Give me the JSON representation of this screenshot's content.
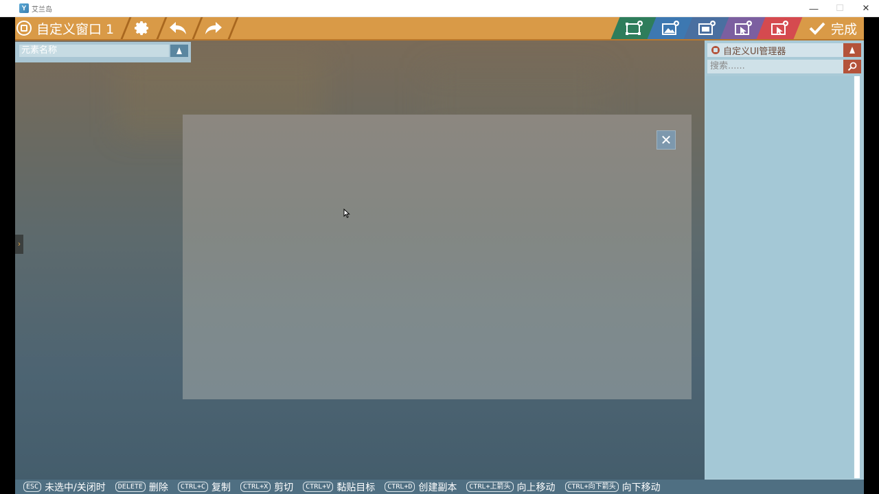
{
  "os_window": {
    "title": "艾兰岛",
    "minimize_glyph": "—",
    "maximize_glyph": "☐",
    "close_glyph": "✕"
  },
  "toolbar": {
    "window_name": "自定义窗口 1",
    "done_label": "完成",
    "colors": {
      "bar": "#d99a47",
      "green": "#2e7d5b",
      "blue": "#3d78b1",
      "slate": "#4a6fa0",
      "purple": "#7c5fa0",
      "red": "#d54a4f"
    },
    "right_tools": [
      {
        "name": "add-frame-icon"
      },
      {
        "name": "add-image-icon"
      },
      {
        "name": "add-panel-icon"
      },
      {
        "name": "add-button-icon"
      },
      {
        "name": "add-clickable-icon"
      }
    ]
  },
  "canvas": {
    "name_placeholder": "元素名称",
    "panel_close_glyph": "✕",
    "side_handle_glyph": "›"
  },
  "right_panel": {
    "title": "自定义UI管理器",
    "search_placeholder": "搜索......"
  },
  "shortcuts": [
    {
      "key": "ESC",
      "label": "未选中/关闭时"
    },
    {
      "key": "DELETE",
      "label": "删除"
    },
    {
      "key": "CTRL+C",
      "label": "复制"
    },
    {
      "key": "CTRL+X",
      "label": "剪切"
    },
    {
      "key": "CTRL+V",
      "label": "黏贴目标"
    },
    {
      "key": "CTRL+D",
      "label": "创建副本"
    },
    {
      "key": "CTRL+上箭头",
      "label": "向上移动"
    },
    {
      "key": "CTRL+向下箭头",
      "label": "向下移动"
    }
  ]
}
